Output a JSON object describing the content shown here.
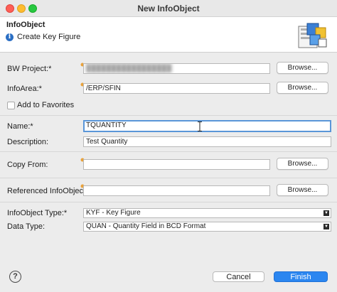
{
  "window": {
    "title": "New InfoObject"
  },
  "header": {
    "title": "InfoObject",
    "message": "Create Key Figure",
    "message_icon": "info-icon",
    "graphic_icon": "wizard-graphic-icon"
  },
  "form": {
    "bw_project": {
      "label": "BW Project:*",
      "value": "█████████████████",
      "button": "Browse..."
    },
    "info_area": {
      "label": "InfoArea:*",
      "value": "/ERP/SFIN",
      "button": "Browse..."
    },
    "add_to_favorites": {
      "label": "Add to Favorites",
      "checked": false
    },
    "name": {
      "label": "Name:*",
      "value": "TQUANTITY"
    },
    "description": {
      "label": "Description:",
      "value": "Test Quantity"
    },
    "copy_from": {
      "label": "Copy From:",
      "value": "",
      "button": "Browse..."
    },
    "referenced": {
      "label": "Referenced InfoObject:",
      "value": "",
      "button": "Browse..."
    },
    "infoobject_type": {
      "label": "InfoObject Type:*",
      "value": "KYF - Key Figure"
    },
    "data_type": {
      "label": "Data Type:",
      "value": "QUAN - Quantity Field in BCD Format"
    }
  },
  "footer": {
    "help_icon": "help-icon",
    "cancel": "Cancel",
    "finish": "Finish"
  },
  "colors": {
    "accent": "#2b86f0",
    "focus": "#5a96d8",
    "info": "#2b6fc4"
  }
}
